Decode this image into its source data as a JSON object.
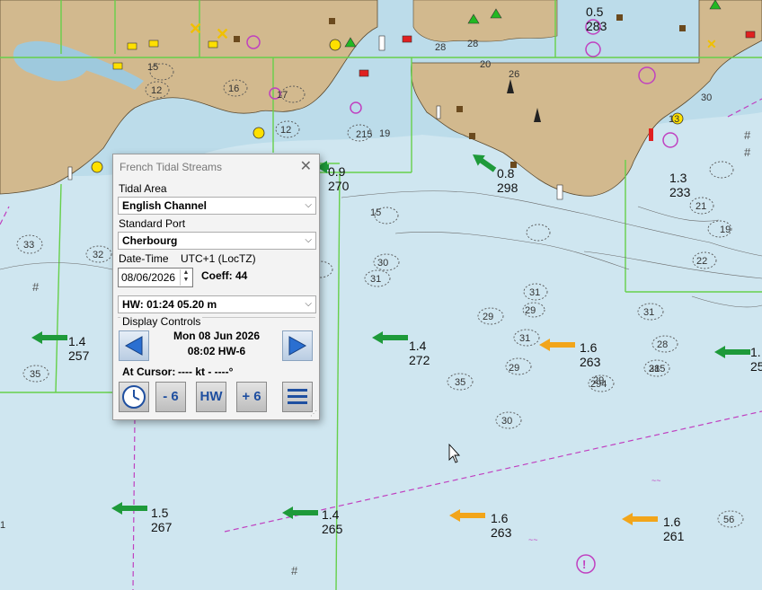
{
  "panel": {
    "title": "French Tidal Streams",
    "close_glyph": "✕",
    "tidal_area_label": "Tidal Area",
    "tidal_area_value": "English Channel",
    "standard_port_label": "Standard Port",
    "standard_port_value": "Cherbourg",
    "datetime_label": "Date-Time",
    "timezone": "UTC+1  (LocTZ)",
    "date_value": "08/06/2026",
    "coeff_text": "Coeff:  44",
    "hw_value": "HW: 01:24      05.20 m",
    "display_controls_label": "Display Controls",
    "display_date": "Mon 08 Jun 2026",
    "display_time": "08:02    HW-6",
    "at_cursor_label": "At Cursor:",
    "at_cursor_value": "---- kt  -  ----°",
    "btn_minus": "- 6",
    "btn_hw": "HW",
    "btn_plus": "+ 6"
  },
  "colors": {
    "sea": "#cfe6f0",
    "land": "#d2b98e",
    "green_arrow": "#1e9a3a",
    "orange_arrow": "#f2a51a",
    "chart_grid": "#66d04a",
    "boundary": "#c040c0"
  },
  "tidal_arrows": [
    {
      "speed": "1.4",
      "direction": "257",
      "color": "green"
    },
    {
      "speed": "1.4",
      "direction": "272",
      "color": "green"
    },
    {
      "speed": "1.6",
      "direction": "263",
      "color": "orange"
    },
    {
      "speed": "1.6",
      "direction": "263",
      "color": "orange"
    },
    {
      "speed": "1.5",
      "direction": "267",
      "color": "green"
    },
    {
      "speed": "1.4",
      "direction": "265",
      "color": "green"
    },
    {
      "speed": "1.6",
      "direction": "261",
      "color": "orange"
    },
    {
      "speed": "0.9",
      "direction": "270",
      "color": "green"
    },
    {
      "speed": "0.8",
      "direction": "298",
      "color": "green"
    },
    {
      "speed": "1.3",
      "direction": "233",
      "color": "green"
    },
    {
      "speed": "1.",
      "direction": "25",
      "color": "green"
    },
    {
      "speed": "0.5",
      "direction": "283",
      "color": "green"
    }
  ],
  "depths": [
    "33",
    "32",
    "35",
    "30",
    "31",
    "31",
    "29",
    "29",
    "31",
    "35",
    "30",
    "31",
    "28",
    "285",
    "294",
    "29",
    "29",
    "31",
    "56",
    "15",
    "12",
    "16",
    "12",
    "28",
    "26",
    "28",
    "20",
    "19",
    "22",
    "21",
    "13",
    "17",
    "15",
    "19",
    "215",
    "30",
    "1"
  ]
}
